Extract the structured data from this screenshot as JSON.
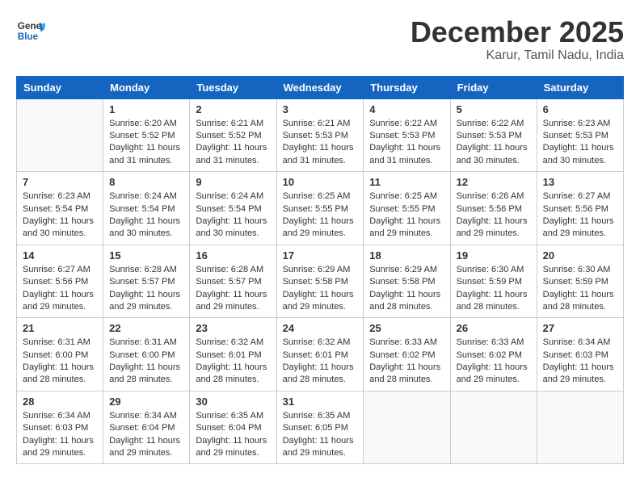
{
  "logo": {
    "line1": "General",
    "line2": "Blue"
  },
  "title": "December 2025",
  "location": "Karur, Tamil Nadu, India",
  "days_header": [
    "Sunday",
    "Monday",
    "Tuesday",
    "Wednesday",
    "Thursday",
    "Friday",
    "Saturday"
  ],
  "weeks": [
    [
      {
        "day": "",
        "info": ""
      },
      {
        "day": "1",
        "info": "Sunrise: 6:20 AM\nSunset: 5:52 PM\nDaylight: 11 hours\nand 31 minutes."
      },
      {
        "day": "2",
        "info": "Sunrise: 6:21 AM\nSunset: 5:52 PM\nDaylight: 11 hours\nand 31 minutes."
      },
      {
        "day": "3",
        "info": "Sunrise: 6:21 AM\nSunset: 5:53 PM\nDaylight: 11 hours\nand 31 minutes."
      },
      {
        "day": "4",
        "info": "Sunrise: 6:22 AM\nSunset: 5:53 PM\nDaylight: 11 hours\nand 31 minutes."
      },
      {
        "day": "5",
        "info": "Sunrise: 6:22 AM\nSunset: 5:53 PM\nDaylight: 11 hours\nand 30 minutes."
      },
      {
        "day": "6",
        "info": "Sunrise: 6:23 AM\nSunset: 5:53 PM\nDaylight: 11 hours\nand 30 minutes."
      }
    ],
    [
      {
        "day": "7",
        "info": "Sunrise: 6:23 AM\nSunset: 5:54 PM\nDaylight: 11 hours\nand 30 minutes."
      },
      {
        "day": "8",
        "info": "Sunrise: 6:24 AM\nSunset: 5:54 PM\nDaylight: 11 hours\nand 30 minutes."
      },
      {
        "day": "9",
        "info": "Sunrise: 6:24 AM\nSunset: 5:54 PM\nDaylight: 11 hours\nand 30 minutes."
      },
      {
        "day": "10",
        "info": "Sunrise: 6:25 AM\nSunset: 5:55 PM\nDaylight: 11 hours\nand 29 minutes."
      },
      {
        "day": "11",
        "info": "Sunrise: 6:25 AM\nSunset: 5:55 PM\nDaylight: 11 hours\nand 29 minutes."
      },
      {
        "day": "12",
        "info": "Sunrise: 6:26 AM\nSunset: 5:56 PM\nDaylight: 11 hours\nand 29 minutes."
      },
      {
        "day": "13",
        "info": "Sunrise: 6:27 AM\nSunset: 5:56 PM\nDaylight: 11 hours\nand 29 minutes."
      }
    ],
    [
      {
        "day": "14",
        "info": "Sunrise: 6:27 AM\nSunset: 5:56 PM\nDaylight: 11 hours\nand 29 minutes."
      },
      {
        "day": "15",
        "info": "Sunrise: 6:28 AM\nSunset: 5:57 PM\nDaylight: 11 hours\nand 29 minutes."
      },
      {
        "day": "16",
        "info": "Sunrise: 6:28 AM\nSunset: 5:57 PM\nDaylight: 11 hours\nand 29 minutes."
      },
      {
        "day": "17",
        "info": "Sunrise: 6:29 AM\nSunset: 5:58 PM\nDaylight: 11 hours\nand 29 minutes."
      },
      {
        "day": "18",
        "info": "Sunrise: 6:29 AM\nSunset: 5:58 PM\nDaylight: 11 hours\nand 28 minutes."
      },
      {
        "day": "19",
        "info": "Sunrise: 6:30 AM\nSunset: 5:59 PM\nDaylight: 11 hours\nand 28 minutes."
      },
      {
        "day": "20",
        "info": "Sunrise: 6:30 AM\nSunset: 5:59 PM\nDaylight: 11 hours\nand 28 minutes."
      }
    ],
    [
      {
        "day": "21",
        "info": "Sunrise: 6:31 AM\nSunset: 6:00 PM\nDaylight: 11 hours\nand 28 minutes."
      },
      {
        "day": "22",
        "info": "Sunrise: 6:31 AM\nSunset: 6:00 PM\nDaylight: 11 hours\nand 28 minutes."
      },
      {
        "day": "23",
        "info": "Sunrise: 6:32 AM\nSunset: 6:01 PM\nDaylight: 11 hours\nand 28 minutes."
      },
      {
        "day": "24",
        "info": "Sunrise: 6:32 AM\nSunset: 6:01 PM\nDaylight: 11 hours\nand 28 minutes."
      },
      {
        "day": "25",
        "info": "Sunrise: 6:33 AM\nSunset: 6:02 PM\nDaylight: 11 hours\nand 28 minutes."
      },
      {
        "day": "26",
        "info": "Sunrise: 6:33 AM\nSunset: 6:02 PM\nDaylight: 11 hours\nand 29 minutes."
      },
      {
        "day": "27",
        "info": "Sunrise: 6:34 AM\nSunset: 6:03 PM\nDaylight: 11 hours\nand 29 minutes."
      }
    ],
    [
      {
        "day": "28",
        "info": "Sunrise: 6:34 AM\nSunset: 6:03 PM\nDaylight: 11 hours\nand 29 minutes."
      },
      {
        "day": "29",
        "info": "Sunrise: 6:34 AM\nSunset: 6:04 PM\nDaylight: 11 hours\nand 29 minutes."
      },
      {
        "day": "30",
        "info": "Sunrise: 6:35 AM\nSunset: 6:04 PM\nDaylight: 11 hours\nand 29 minutes."
      },
      {
        "day": "31",
        "info": "Sunrise: 6:35 AM\nSunset: 6:05 PM\nDaylight: 11 hours\nand 29 minutes."
      },
      {
        "day": "",
        "info": ""
      },
      {
        "day": "",
        "info": ""
      },
      {
        "day": "",
        "info": ""
      }
    ]
  ]
}
